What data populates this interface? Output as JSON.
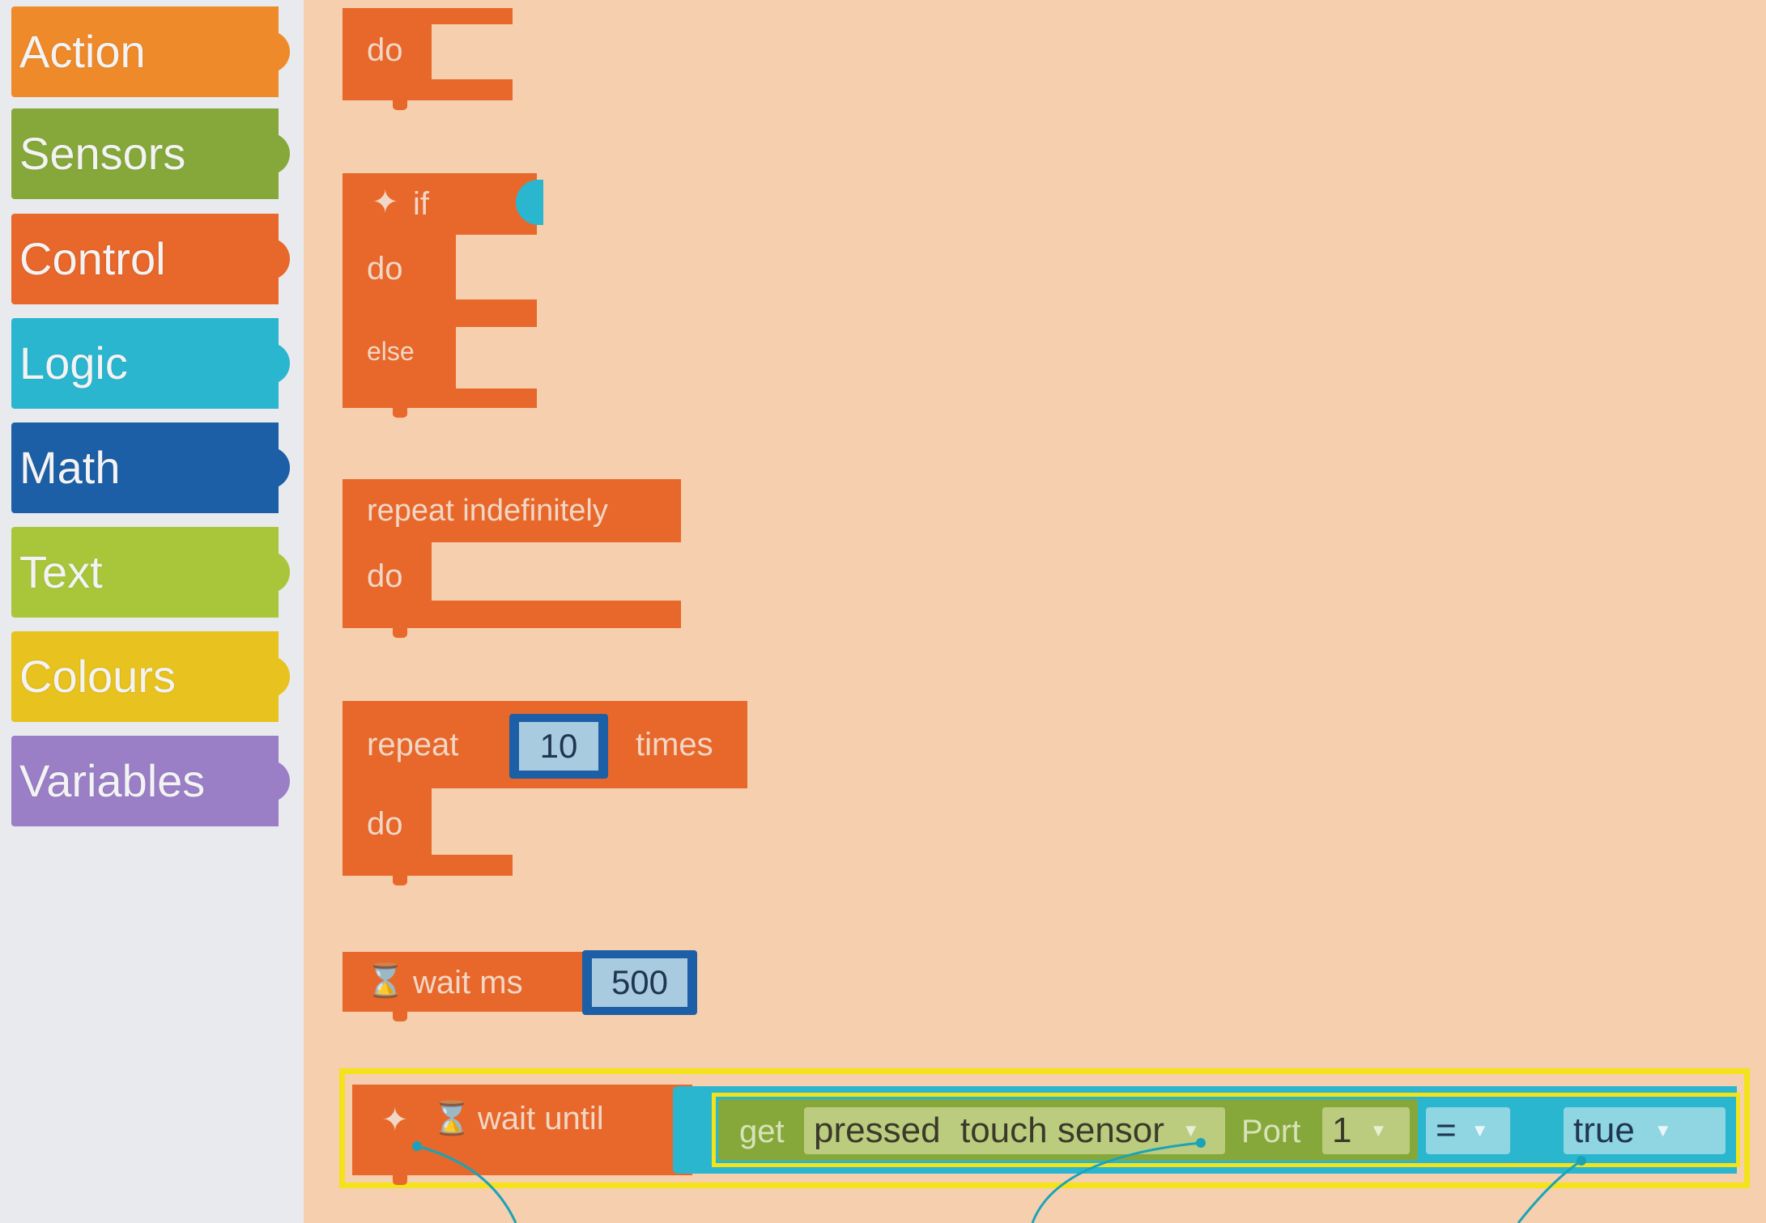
{
  "sidebar": {
    "categories": [
      {
        "label": "Action",
        "color": "#ef8a2a"
      },
      {
        "label": "Sensors",
        "color": "#86a83a"
      },
      {
        "label": "Control",
        "color": "#e8672a"
      },
      {
        "label": "Logic",
        "color": "#2bb6d0"
      },
      {
        "label": "Math",
        "color": "#1d5fa6"
      },
      {
        "label": "Text",
        "color": "#a9c63a"
      },
      {
        "label": "Colours",
        "color": "#e8c21e"
      },
      {
        "label": "Variables",
        "color": "#9a7fc7"
      }
    ]
  },
  "blocks": {
    "do_block": {
      "do_label": "do"
    },
    "if_block": {
      "if_label": "if",
      "do_label": "do",
      "else_label": "else"
    },
    "repeat_forever": {
      "label": "repeat indefinitely",
      "do_label": "do"
    },
    "repeat_times": {
      "repeat_label": "repeat",
      "count": "10",
      "times_label": "times",
      "do_label": "do"
    },
    "wait_ms": {
      "label": "wait ms",
      "value": "500"
    },
    "wait_until": {
      "label": "wait until",
      "get_label": "get",
      "sensor_field": "pressed  touch sensor",
      "port_label": "Port",
      "port_value": "1",
      "operator": "=",
      "compare_value": "true"
    }
  },
  "colors": {
    "control": "#e8672a",
    "workspace": "#f6cfae",
    "highlight": "#f4e21a",
    "logic": "#2bb6d0",
    "sensor": "#86a83a",
    "callout": "#1aa3b8"
  }
}
